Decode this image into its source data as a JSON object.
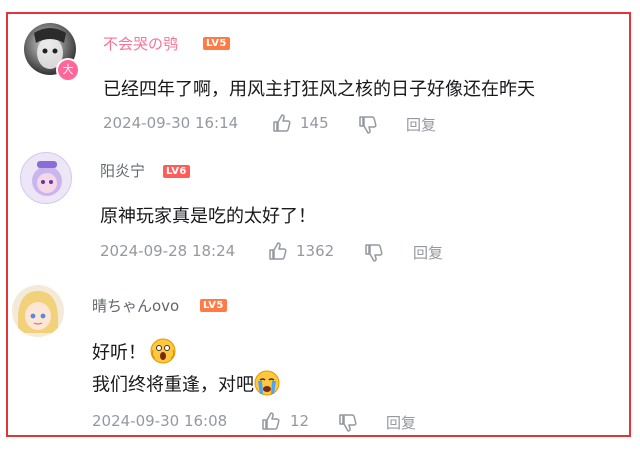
{
  "comments": [
    {
      "username": "不会哭の鸮",
      "level": "LV5",
      "text": "已经四年了啊，用风主打狂风之核的日子好像还在昨天",
      "timestamp": "2024-09-30 16:14",
      "likes": "145",
      "reply_label": "回复",
      "name_color": "#fb7299"
    },
    {
      "username": "阳炎宁",
      "level": "LV6",
      "text": "原神玩家真是吃的太好了！",
      "timestamp": "2024-09-28 18:24",
      "likes": "1362",
      "reply_label": "回复",
      "name_color": "#61666d"
    },
    {
      "username": "晴ちゃんovo",
      "level": "LV5",
      "text_line1": "好听！",
      "text_line2": "我们终将重逢，对吧",
      "timestamp": "2024-09-30 16:08",
      "likes": "12",
      "reply_label": "回复",
      "name_color": "#61666d"
    }
  ],
  "colors": {
    "frame": "#e0363b",
    "level_badge": "#ff7a45",
    "meta": "#9499a0",
    "vip": "#fb7299"
  }
}
